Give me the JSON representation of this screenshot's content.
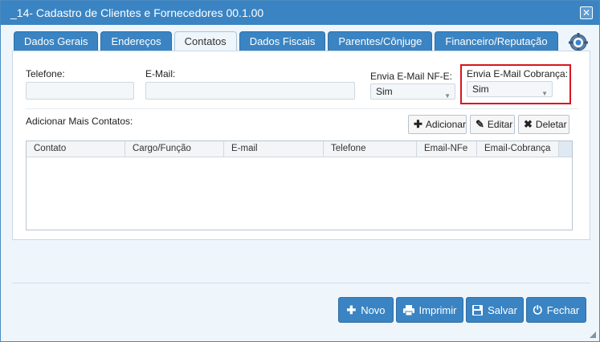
{
  "window": {
    "title": "_14- Cadastro de Clientes e Fornecedores 00.1.00",
    "close_glyph": "✕"
  },
  "tabs": [
    {
      "label": "Dados Gerais"
    },
    {
      "label": "Endereços"
    },
    {
      "label": "Contatos"
    },
    {
      "label": "Dados Fiscais"
    },
    {
      "label": "Parentes/Cônjuge"
    },
    {
      "label": "Financeiro/Reputação"
    }
  ],
  "form": {
    "telefone_label": "Telefone:",
    "telefone_value": "",
    "email_label": "E-Mail:",
    "email_value": "",
    "nfe_label": "Envia E-Mail NF-E:",
    "nfe_value": "Sim",
    "cobranca_label": "Envia E-Mail Cobrança:",
    "cobranca_value": "Sim"
  },
  "contacts": {
    "label": "Adicionar Mais Contatos:",
    "add_label": "Adicionar",
    "edit_label": "Editar",
    "delete_label": "Deletar",
    "columns": [
      "Contato",
      "Cargo/Função",
      "E-mail",
      "Telefone",
      "Email-NFe",
      "Email-Cobrança"
    ],
    "rows": []
  },
  "footer": {
    "novo_label": "Novo",
    "imprimir_label": "Imprimir",
    "salvar_label": "Salvar",
    "fechar_label": "Fechar"
  },
  "icons": {
    "plus": "✚",
    "edit": "✎",
    "delete": "✖",
    "arrow": "▼",
    "power": "⏻"
  },
  "colors": {
    "primary": "#3a84c3",
    "highlight": "#d9141e"
  }
}
